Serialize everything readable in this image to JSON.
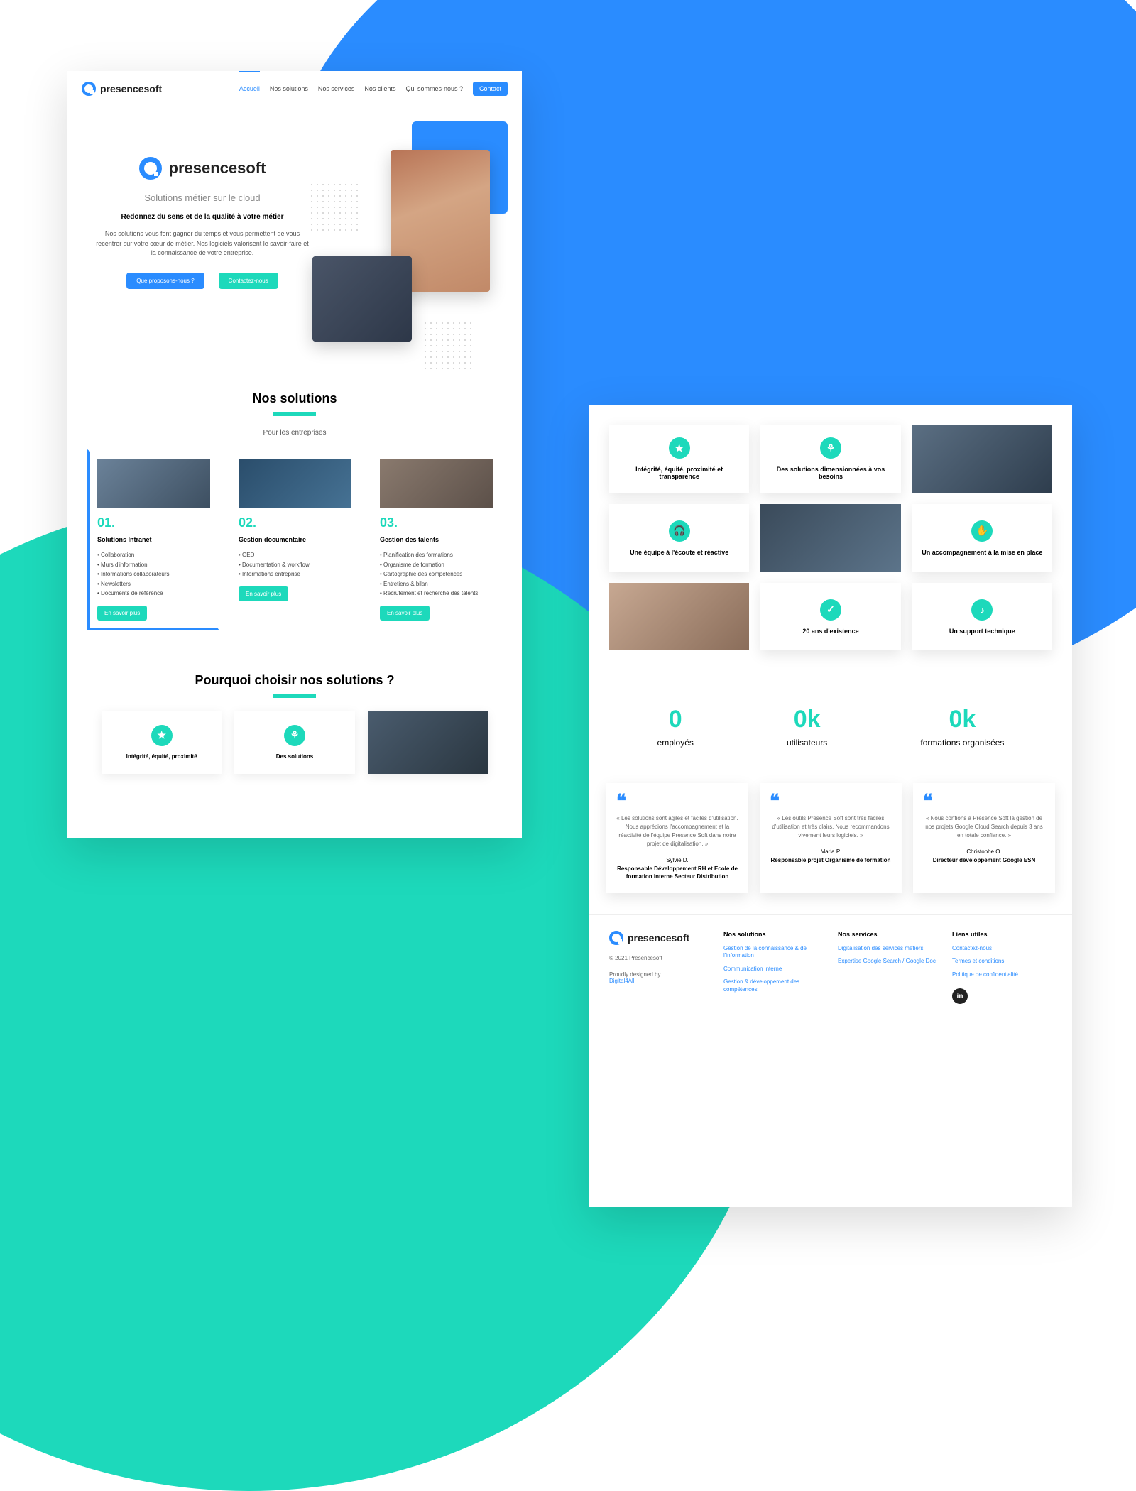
{
  "brand": "presencesoft",
  "nav": {
    "items": [
      "Accueil",
      "Nos solutions",
      "Nos services",
      "Nos clients",
      "Qui sommes-nous ?"
    ],
    "contact_label": "Contact"
  },
  "hero": {
    "subtitle": "Solutions métier sur le cloud",
    "headline": "Redonnez du sens et de la qualité à votre métier",
    "body": "Nos solutions vous font gagner du temps et vous permettent de vous recentrer sur votre cœur de métier. Nos logiciels valorisent le savoir-faire et la connaissance de votre entreprise.",
    "cta1": "Que proposons-nous ?",
    "cta2": "Contactez-nous"
  },
  "solutions": {
    "title": "Nos solutions",
    "subtitle": "Pour les entreprises",
    "cards": [
      {
        "num": "01.",
        "title": "Solutions Intranet",
        "items": [
          "Collaboration",
          "Murs d'information",
          "Informations collaborateurs",
          "Newsletters",
          "Documents de référence"
        ]
      },
      {
        "num": "02.",
        "title": "Gestion documentaire",
        "items": [
          "GED",
          "Documentation & workflow",
          "Informations entreprise"
        ]
      },
      {
        "num": "03.",
        "title": "Gestion des talents",
        "items": [
          "Planification des formations",
          "Organisme de formation",
          "Cartographie des compétences",
          "Entretiens & bilan",
          "Recrutement et recherche des talents"
        ]
      }
    ],
    "cta": "En savoir plus"
  },
  "why": {
    "title": "Pourquoi choisir nos solutions ?",
    "cells": [
      "Intégrité, équité, proximité et transparence",
      "Des solutions dimensionnées à vos besoins",
      "",
      "Une équipe à l'écoute et réactive",
      "",
      "Un accompagnement à la mise en place",
      "",
      "20 ans d'existence",
      "Un support technique"
    ],
    "bottom_preview": [
      "Intégrité, équité, proximité",
      "Des solutions"
    ]
  },
  "stats": [
    {
      "n": "0",
      "l": "employés"
    },
    {
      "n": "0k",
      "l": "utilisateurs"
    },
    {
      "n": "0k",
      "l": "formations organisées"
    }
  ],
  "testimonials": [
    {
      "quote": "« Les solutions sont agiles et faciles d'utilisation. Nous apprécions l'accompagnement et la réactivité de l'équipe Presence Soft dans notre projet de digitalisation. »",
      "name": "Sylvie D.",
      "role": "Responsable Développement RH et Ecole de formation interne\nSecteur Distribution"
    },
    {
      "quote": "« Les outils Presence Soft sont très faciles d'utilisation et très clairs. Nous recommandons vivement leurs logiciels. »",
      "name": "Maria P.",
      "role": "Responsable projet\nOrganisme de formation"
    },
    {
      "quote": "« Nous confions à Presence Soft la gestion de nos projets Google Cloud Search depuis 3 ans en totale confiance. »",
      "name": "Christophe O.",
      "role": "Directeur développement\nGoogle ESN"
    }
  ],
  "footer": {
    "copyright": "© 2021 Presencesoft",
    "designed_prefix": "Proudly designed by ",
    "designed_link": "Digital4All",
    "cols": [
      {
        "h": "Nos solutions",
        "links": [
          "Gestion de la connaissance & de l'information",
          "Communication interne",
          "Gestion & développement des compétences"
        ]
      },
      {
        "h": "Nos services",
        "links": [
          "Digitalisation des services métiers",
          "Expertise Google Search / Google Doc"
        ]
      },
      {
        "h": "Liens utiles",
        "links": [
          "Contactez-nous",
          "Termes et conditions",
          "Politique de confidentialité"
        ]
      }
    ]
  }
}
